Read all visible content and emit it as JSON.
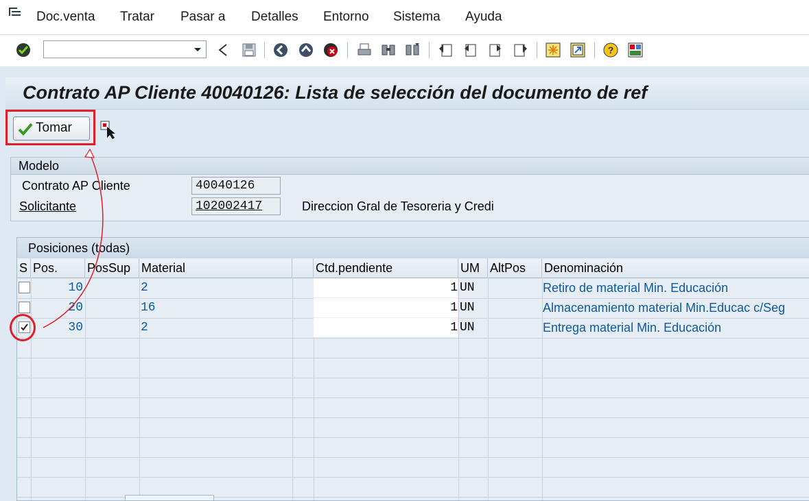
{
  "menu": {
    "items": [
      {
        "label": "Doc.venta"
      },
      {
        "label": "Tratar"
      },
      {
        "label": "Pasar a"
      },
      {
        "label": "Detalles"
      },
      {
        "label": "Entorno"
      },
      {
        "label": "Sistema"
      },
      {
        "label": "Ayuda"
      }
    ]
  },
  "toolbar": {
    "command_value": "",
    "icons": [
      "enter-icon",
      "command-dropdown-icon",
      "back-icon",
      "save-icon",
      "back-circle-icon",
      "exit-icon",
      "cancel-icon",
      "print-icon",
      "find-icon",
      "find-next-icon",
      "first-page-icon",
      "previous-page-icon",
      "next-page-icon",
      "last-page-icon",
      "new-session-icon",
      "shortcut-icon",
      "help-icon",
      "customize-layout-icon"
    ]
  },
  "title": "Contrato AP Cliente 40040126: Lista de selección del documento de ref",
  "app_toolbar": {
    "tomar_label": "Tomar",
    "icons": [
      "checkmark-icon",
      "select-block-icon"
    ]
  },
  "modelo": {
    "title": "Modelo",
    "contrato_label": "Contrato AP Cliente",
    "contrato_value": "40040126",
    "solicitante_label": "Solicitante",
    "solicitante_value": "102002417",
    "solicitante_name": "Direccion Gral de Tesoreria y Credi"
  },
  "positions": {
    "title": "Posiciones (todas)",
    "columns": {
      "s": "S",
      "pos": "Pos.",
      "possup": "PosSup",
      "material": "Material",
      "ctd": "Ctd.pendiente",
      "um": "UM",
      "altpos": "AltPos",
      "denom": "Denominación"
    },
    "rows": [
      {
        "checked": false,
        "pos": "10",
        "material": "2",
        "ctd": "1",
        "um": "UN",
        "denom": "Retiro de material Min. Educación"
      },
      {
        "checked": false,
        "pos": "20",
        "material": "16",
        "ctd": "1",
        "um": "UN",
        "denom": "Almacenamiento material Min.Educac c/Seg"
      },
      {
        "checked": true,
        "pos": "30",
        "material": "2",
        "ctd": "1",
        "um": "UN",
        "denom": "Entrega material Min. Educación"
      }
    ]
  },
  "colors": {
    "highlight": "#e01e25",
    "link_text": "#0c5a9f",
    "background": "#dfe9f3"
  }
}
